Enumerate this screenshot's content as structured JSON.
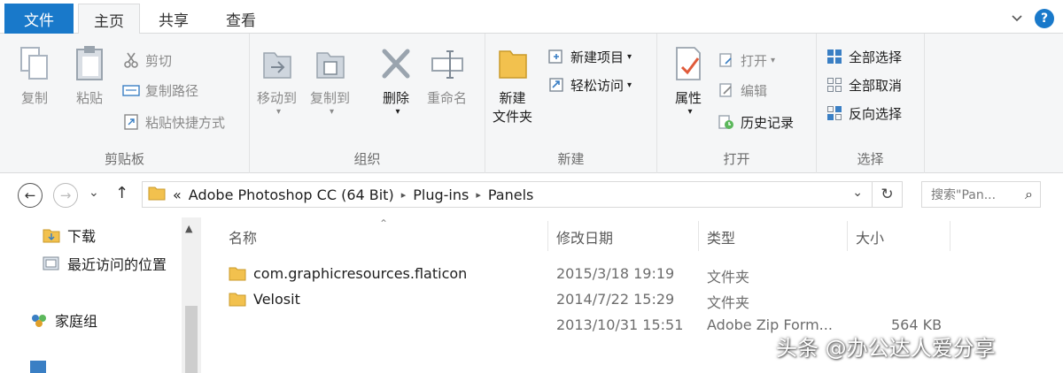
{
  "ribbon_tabs": {
    "file": "文件",
    "home": "主页",
    "share": "共享",
    "view": "查看"
  },
  "help_label": "?",
  "clipboard": {
    "copy": "复制",
    "paste": "粘贴",
    "cut": "剪切",
    "copy_path": "复制路径",
    "paste_shortcut": "粘贴快捷方式",
    "label": "剪贴板"
  },
  "organize": {
    "move_to": "移动到",
    "copy_to": "复制到",
    "delete": "删除",
    "rename": "重命名",
    "label": "组织"
  },
  "new": {
    "new_folder_line1": "新建",
    "new_folder_line2": "文件夹",
    "new_item": "新建项目",
    "easy_access": "轻松访问",
    "label": "新建"
  },
  "open": {
    "properties": "属性",
    "open": "打开",
    "edit": "编辑",
    "history": "历史记录",
    "label": "打开"
  },
  "select": {
    "select_all": "全部选择",
    "select_none": "全部取消",
    "invert": "反向选择",
    "label": "选择"
  },
  "address": {
    "overflow": "«",
    "segments": [
      "Adobe Photoshop CC (64 Bit)",
      "Plug-ins",
      "Panels"
    ],
    "separator": "▸",
    "dropdown": "⌄",
    "refresh": "↻"
  },
  "search": {
    "placeholder": "搜索\"Pan...",
    "icon": "⌕"
  },
  "nav": {
    "back": "←",
    "forward": "→",
    "recent": "⌄",
    "up": "↑"
  },
  "nav_pane": {
    "items": [
      {
        "label": "下载",
        "icon": "folder-download-icon"
      },
      {
        "label": "最近访问的位置",
        "icon": "recent-places-icon"
      },
      {
        "label": "家庭组",
        "icon": "homegroup-icon"
      }
    ]
  },
  "columns": {
    "name": "名称",
    "modified": "修改日期",
    "type": "类型",
    "size": "大小",
    "sort_indicator": "⌃"
  },
  "files": [
    {
      "name": "com.graphicresources.flaticon",
      "modified": "2015/3/18 19:19",
      "type": "文件夹",
      "size": ""
    },
    {
      "name": "Velosit",
      "modified": "2014/7/22 15:29",
      "type": "文件夹",
      "size": ""
    },
    {
      "name": "",
      "modified": "2013/10/31 15:51",
      "type": "Adobe Zip Form...",
      "size": "564 KB"
    }
  ],
  "watermark": "头条 @办公达人爱分享",
  "colors": {
    "accent": "#1979ca",
    "folder": "#f2c14e"
  }
}
